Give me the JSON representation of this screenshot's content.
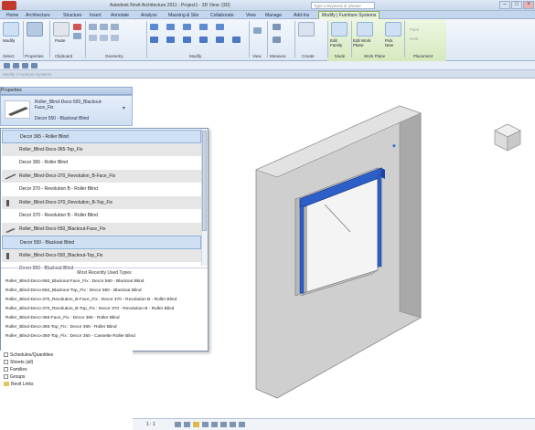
{
  "titlebar": {
    "title": "Autodesk Revit Architecture 2011 - Project1 - 3D View: {3D}",
    "search_placeholder": "Type a keyword or phrase",
    "min": "–",
    "max": "□",
    "close": "×"
  },
  "tabs": [
    "Home",
    "Architecture",
    "Structure",
    "Insert",
    "Annotate",
    "Analyze",
    "Massing & Site",
    "Collaborate",
    "View",
    "Manage",
    "Add-Ins",
    "Modify | Furniture Systems"
  ],
  "ribbon": {
    "panels": [
      "Select",
      "Properties",
      "Clipboard",
      "Geometry",
      "Modify",
      "View",
      "Measure",
      "Create",
      "Mode",
      "Work Plane",
      "Placement"
    ],
    "modify_label": "Modify",
    "paste_label": "Paste",
    "edit_family_label": "Edit Family",
    "edit_work_plane_label": "Edit Work Plane",
    "pick_new_label": "Pick New",
    "face_label": "Face",
    "host_label": "Host"
  },
  "options_bar": {
    "text": "Modify | Furniture Systems"
  },
  "properties": {
    "header": "Properties",
    "type_name": "Roller_Blind-Deco-550_Blackout-Face_Fix",
    "type_sub": "Decor 550 - Blackout Blind",
    "dropdown_rows": [
      {
        "text": "Decor 365 - Roller Blind",
        "kind": "type",
        "selected": true
      },
      {
        "text": "Roller_Blind-Deco-365-Top_Fix",
        "kind": "family",
        "selected": false
      },
      {
        "text": "Decor 365 - Roller Blind",
        "kind": "type",
        "selected": false
      },
      {
        "text": "Roller_Blind-Deco-370_Revolution_B-Face_Fix",
        "kind": "family",
        "selected": false
      },
      {
        "text": "Decor 370 - Revolution B - Roller Blind",
        "kind": "type",
        "selected": false
      },
      {
        "text": "Roller_Blind-Deco-370_Revolution_B-Top_Fix",
        "kind": "family",
        "selected": false
      },
      {
        "text": "Decor 370 - Revolution B - Roller Blind",
        "kind": "type",
        "selected": false
      },
      {
        "text": "Roller_Blind-Deco-550_Blackout-Face_Fix",
        "kind": "family",
        "selected": false
      },
      {
        "text": "Decor 550 - Blackout Blind",
        "kind": "type",
        "selected": true
      },
      {
        "text": "Roller_Blind-Deco-550_Blackout-Top_Fix",
        "kind": "family",
        "selected": false
      },
      {
        "text": "Decor 550 - Blackout Blind",
        "kind": "type",
        "selected": false
      }
    ],
    "mru_title": "Most Recently Used Types",
    "mru_rows": [
      "Roller_Blind-Deco-550_Blackout-Face_Fix : Decor 550 - Blackout Blind",
      "Roller_Blind-Deco-550_Blackout-Top_Fix : Decor 550 - Blackout Blind",
      "Roller_Blind-Deco-370_Revolution_B-Face_Fix : Decor 370 - Revolution B - Roller Blind",
      "Roller_Blind-Deco-370_Revolution_B-Top_Fix : Decor 370 - Revolution B - Roller Blind",
      "Roller_Blind-Deco-365-Face_Fix : Decor 365 - Roller Blind",
      "Roller_Blind-Deco-365-Top_Fix : Decor 365 - Roller Blind",
      "Roller_Blind-Deco-360-Top_Fix : Decor 360 - Cassette Roller Blind"
    ]
  },
  "browser": {
    "items": [
      "Schedules/Quantities",
      "Sheets (all)",
      "Families",
      "Groups",
      "Revit Links"
    ]
  },
  "status": {
    "scale": "1 : 1"
  },
  "colors": {
    "accent": "#2f6fd6",
    "ribbon_context": "#d5e9bd",
    "blind": "#2d5fc8"
  }
}
